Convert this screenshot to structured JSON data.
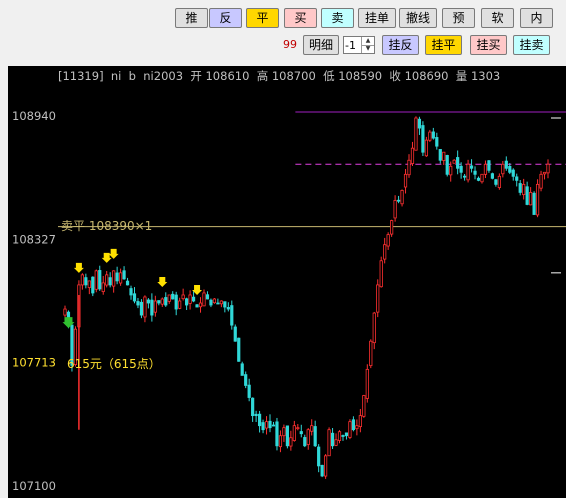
{
  "toolbar": {
    "row1": [
      {
        "name": "push-button",
        "label": "推",
        "bg": "#e0e0e0"
      },
      {
        "name": "reverse-button",
        "label": "反",
        "bg": "#c8c8ff"
      },
      {
        "name": "close-button",
        "label": "平",
        "bg": "#ffd700"
      },
      {
        "name": "buy-button",
        "label": "买",
        "bg": "#ffc8c8"
      },
      {
        "name": "sell-button",
        "label": "卖",
        "bg": "#c0ffff"
      },
      {
        "name": "pending-order-button",
        "label": "挂单",
        "bg": "#e0e0e0"
      },
      {
        "name": "cancel-order-button",
        "label": "撤线",
        "bg": "#e0e0e0"
      },
      {
        "name": "preset-button",
        "label": "预",
        "bg": "#e0e0e0"
      },
      {
        "name": "soft-button",
        "label": "软",
        "bg": "#e0e0e0"
      },
      {
        "name": "inner-button",
        "label": "内",
        "bg": "#e0e0e0"
      }
    ],
    "row2": {
      "count_label": "99",
      "detail_label": "明细",
      "quantity_value": "-1",
      "buttons": [
        {
          "name": "pending-reverse-button",
          "label": "挂反",
          "bg": "#c8c8ff"
        },
        {
          "name": "pending-close-button",
          "label": "挂平",
          "bg": "#ffd700"
        },
        {
          "name": "pending-buy-button",
          "label": "挂买",
          "bg": "#ffc8c8"
        },
        {
          "name": "pending-sell-button",
          "label": "挂卖",
          "bg": "#c0ffff"
        }
      ]
    }
  },
  "info_bar": {
    "text": "[11319]  ni  b  ni2003  开 108610  高 108700  低 108590  收 108690  量 1303  "
  },
  "annotations": {
    "sell_close_line": "卖平 108390×1",
    "profit": "615元（615点）"
  },
  "colors": {
    "bg": "#000000",
    "up": "#ff3030",
    "down": "#30d8d8",
    "axis_text": "#c0c0c0",
    "yellow_text": "#ffe030",
    "sell_line": "#c8b870",
    "purple_line": "#a020c0",
    "magenta_dash": "#e040e0"
  },
  "chart_data": {
    "type": "candlestick",
    "y_ticks": [
      108940,
      108327,
      107713,
      107100
    ],
    "y_highlighted_tick": 107713,
    "ylim": [
      107100,
      108960
    ],
    "reference_lines": [
      {
        "label": "卖平 108390×1",
        "value": 108390,
        "style": "solid",
        "color": "#c8b870"
      },
      {
        "value": 108960,
        "style": "solid",
        "color": "#a020c0",
        "starts_at_fraction": 0.515
      },
      {
        "value": 108700,
        "style": "dashed",
        "color": "#e040e0",
        "starts_at_fraction": 0.515
      }
    ],
    "close_path": [
      107980,
      107900,
      107700,
      107880,
      108100,
      108150,
      108100,
      108120,
      108060,
      108170,
      108080,
      108110,
      108150,
      108100,
      108170,
      108120,
      108160,
      108130,
      108100,
      108050,
      108020,
      108000,
      107950,
      108040,
      108010,
      107950,
      108020,
      108010,
      108030,
      108000,
      108050,
      108030,
      107980,
      108020,
      108050,
      108000,
      108050,
      108020,
      107990,
      108010,
      108060,
      108030,
      108000,
      108030,
      108010,
      108020,
      107990,
      107980,
      107900,
      107820,
      107720,
      107650,
      107600,
      107540,
      107450,
      107450,
      107400,
      107380,
      107420,
      107390,
      107400,
      107300,
      107350,
      107390,
      107300,
      107340,
      107400,
      107390,
      107360,
      107300,
      107380,
      107400,
      107300,
      107200,
      107150,
      107250,
      107380,
      107300,
      107330,
      107370,
      107350,
      107350,
      107420,
      107380,
      107400,
      107450,
      107550,
      107680,
      107820,
      107960,
      108100,
      108220,
      108300,
      108350,
      108420,
      108520,
      108520,
      108570,
      108650,
      108720,
      108780,
      108930,
      108880,
      108760,
      108820,
      108860,
      108830,
      108790,
      108720,
      108760,
      108650,
      108690,
      108720,
      108680,
      108660,
      108640,
      108700,
      108680,
      108650,
      108620,
      108650,
      108700,
      108670,
      108630,
      108600,
      108640,
      108700,
      108680,
      108660,
      108640,
      108620,
      108560,
      108600,
      108500,
      108560,
      108450,
      108600,
      108650,
      108660,
      108700
    ],
    "signals": [
      {
        "idx": 1,
        "type": "buy-green"
      },
      {
        "idx": 4,
        "type": "sell-yellow"
      },
      {
        "idx": 12,
        "type": "sell-yellow"
      },
      {
        "idx": 14,
        "type": "sell-yellow"
      },
      {
        "idx": 28,
        "type": "sell-yellow"
      },
      {
        "idx": 38,
        "type": "sell-yellow"
      },
      {
        "idx": 144,
        "type": "buy-red"
      }
    ]
  }
}
